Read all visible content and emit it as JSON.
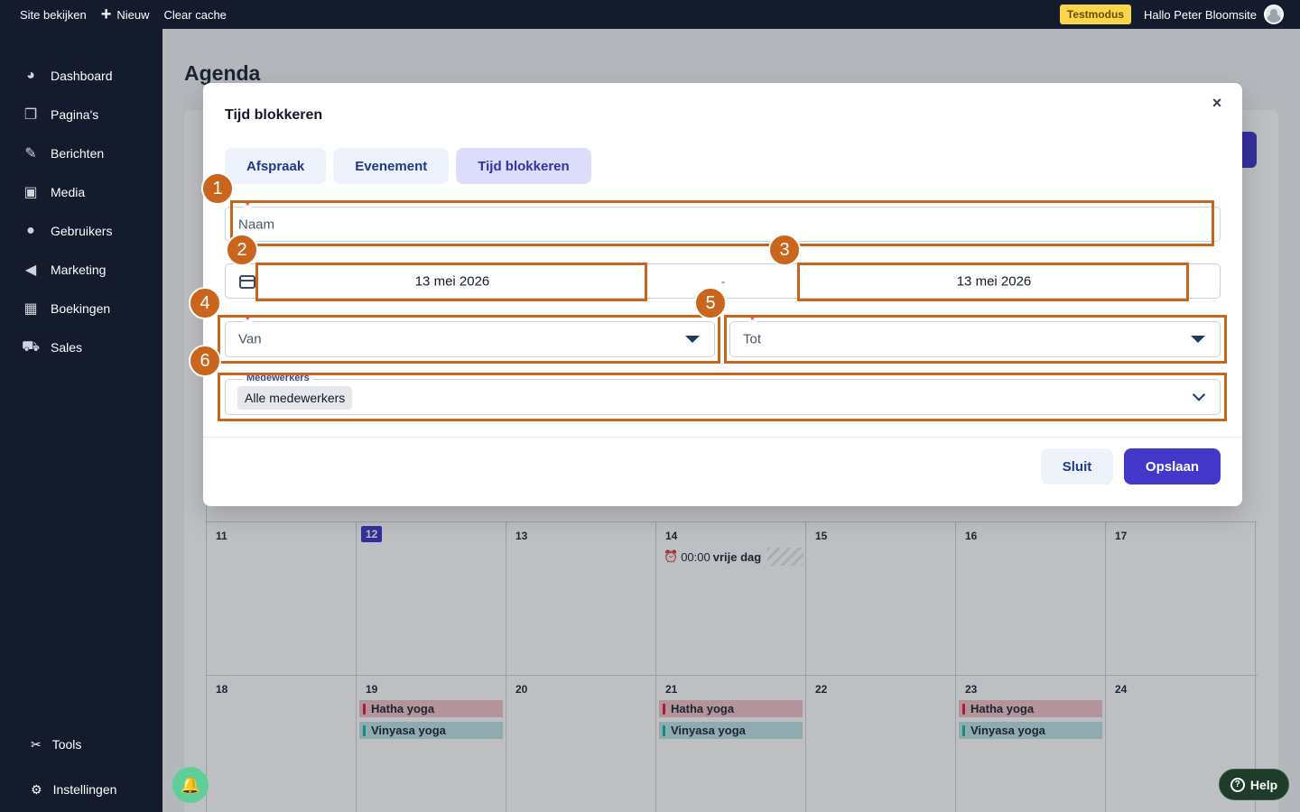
{
  "adminbar": {
    "view_site": "Site bekijken",
    "new": "Nieuw",
    "clear_cache": "Clear cache",
    "test_mode": "Testmodus",
    "greeting": "Hallo Peter Bloomsite"
  },
  "sidebar": {
    "items": [
      {
        "label": "Dashboard",
        "icon": "dashboard-icon"
      },
      {
        "label": "Pagina's",
        "icon": "pages-icon"
      },
      {
        "label": "Berichten",
        "icon": "pin-icon"
      },
      {
        "label": "Media",
        "icon": "media-icon"
      },
      {
        "label": "Gebruikers",
        "icon": "user-icon"
      },
      {
        "label": "Marketing",
        "icon": "megaphone-icon"
      },
      {
        "label": "Boekingen",
        "icon": "calendar-icon"
      },
      {
        "label": "Sales",
        "icon": "cart-icon"
      }
    ],
    "bottom": [
      {
        "label": "Tools",
        "icon": "wrench-icon"
      },
      {
        "label": "Instellingen",
        "icon": "gear-icon"
      }
    ]
  },
  "page": {
    "title": "Agenda"
  },
  "calendar": {
    "week1": [
      "11",
      "12",
      "13",
      "14",
      "15",
      "16",
      "17"
    ],
    "week2": [
      "18",
      "19",
      "20",
      "21",
      "22",
      "23",
      "24"
    ],
    "today": "12",
    "free_day": {
      "time": "00:00",
      "label": "vrije dag"
    },
    "events": {
      "hatha": "Hatha yoga",
      "vinyasa": "Vinyasa yoga"
    }
  },
  "modal": {
    "title": "Tijd blokkeren",
    "close": "×",
    "tabs": [
      "Afspraak",
      "Evenement",
      "Tijd blokkeren"
    ],
    "active_tab": "Tijd blokkeren",
    "name_placeholder": "Naam",
    "required_mark": "*",
    "date_from": "13 mei 2026",
    "date_separator": "-",
    "date_to": "13 mei 2026",
    "from_placeholder": "Van",
    "to_placeholder": "Tot",
    "staff_legend": "Medewerkers",
    "staff_value": "Alle medewerkers",
    "close_button": "Sluit",
    "save_button": "Opslaan"
  },
  "annotations": [
    "1",
    "2",
    "3",
    "4",
    "5",
    "6"
  ],
  "help": {
    "label": "Help"
  },
  "colors": {
    "accent": "#4338ca",
    "highlight": "#c9651c",
    "sidebar": "#141b2d"
  }
}
